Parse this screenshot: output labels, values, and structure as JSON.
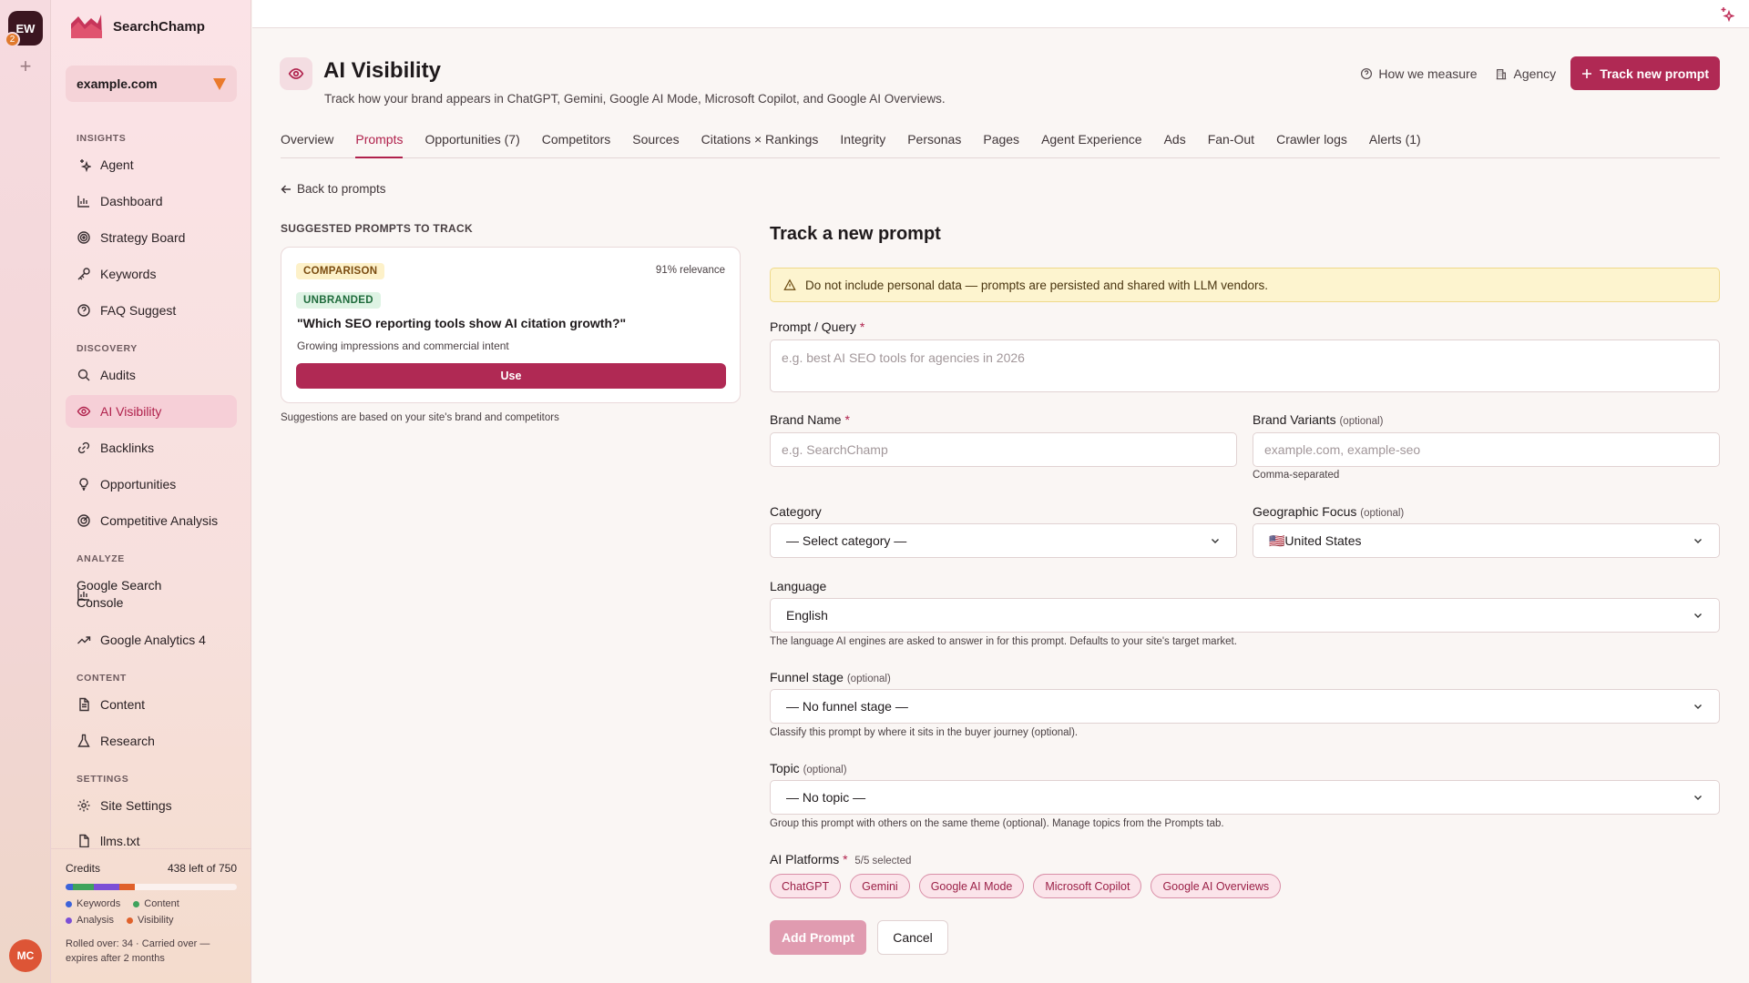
{
  "rail": {
    "workspace_initials": "EW",
    "workspace_count": "2",
    "add": "+",
    "avatar_initials": "MC"
  },
  "brand": {
    "name": "SearchChamp"
  },
  "site": {
    "selected": "example.com"
  },
  "sidebar": {
    "sections": {
      "insights": "INSIGHTS",
      "discovery": "DISCOVERY",
      "analyze": "ANALYZE",
      "content": "CONTENT",
      "settings": "SETTINGS"
    },
    "items": {
      "agent": "Agent",
      "dashboard": "Dashboard",
      "strategy": "Strategy Board",
      "keywords": "Keywords",
      "faq": "FAQ Suggest",
      "audits": "Audits",
      "ai_visibility": "AI Visibility",
      "backlinks": "Backlinks",
      "opportunities": "Opportunities",
      "competitive": "Competitive Analysis",
      "gsc_1": "Google Search",
      "gsc_2": "Console",
      "ga4": "Google Analytics 4",
      "content": "Content",
      "research": "Research",
      "site_settings": "Site Settings",
      "llms": "llms.txt"
    }
  },
  "credits": {
    "label": "Credits",
    "remaining": "438 left of 750",
    "segments": [
      {
        "name": "Keywords",
        "fraction": 0.045,
        "color": "#3d63d9"
      },
      {
        "name": "Content",
        "fraction": 0.12,
        "color": "#3fa35c"
      },
      {
        "name": "Analysis",
        "fraction": 0.15,
        "color": "#7c4fd6"
      },
      {
        "name": "Visibility",
        "fraction": 0.09,
        "color": "#e0612b"
      }
    ],
    "legend": {
      "keywords": "Keywords",
      "content": "Content",
      "analysis": "Analysis",
      "visibility": "Visibility"
    },
    "rollover_1": "Rolled over: 34 · Carried over —",
    "rollover_2": "expires after 2 months"
  },
  "header": {
    "title": "AI Visibility",
    "subtitle": "Track how your brand appears in ChatGPT, Gemini, Google AI Mode, Microsoft Copilot, and Google AI Overviews.",
    "how_we_measure": "How we measure",
    "agency": "Agency",
    "track_new": "Track new prompt"
  },
  "tabs": [
    {
      "label": "Overview"
    },
    {
      "label": "Prompts"
    },
    {
      "label": "Opportunities (7)"
    },
    {
      "label": "Competitors"
    },
    {
      "label": "Sources"
    },
    {
      "label": "Citations × Rankings"
    },
    {
      "label": "Integrity"
    },
    {
      "label": "Personas"
    },
    {
      "label": "Pages"
    },
    {
      "label": "Agent Experience"
    },
    {
      "label": "Ads"
    },
    {
      "label": "Fan-Out"
    },
    {
      "label": "Crawler logs"
    },
    {
      "label": "Alerts (1)"
    }
  ],
  "back": "Back to prompts",
  "suggestions": {
    "heading": "SUGGESTED PROMPTS TO TRACK",
    "card": {
      "type": "COMPARISON",
      "branding": "UNBRANDED",
      "relevance": "91% relevance",
      "query": "\"Which SEO reporting tools show AI citation growth?\"",
      "reason": "Growing impressions and commercial intent",
      "use": "Use"
    },
    "note": "Suggestions are based on your site's brand and competitors"
  },
  "form": {
    "title": "Track a new prompt",
    "warning": "Do not include personal data — prompts are persisted and shared with LLM vendors.",
    "prompt_label": "Prompt / Query",
    "req": "*",
    "prompt_placeholder": "e.g. best AI SEO tools for agencies in 2026",
    "brand_label": "Brand Name",
    "brand_placeholder": "e.g. SearchChamp",
    "variants_label": "Brand Variants",
    "optional": "(optional)",
    "variants_placeholder": "example.com, example-seo",
    "variants_help": "Comma-separated",
    "category_label": "Category",
    "category_value": "— Select category —",
    "geo_label": "Geographic Focus",
    "geo_value": "🇺🇸United States",
    "language_label": "Language",
    "language_value": "English",
    "language_help": "The language AI engines are asked to answer in for this prompt. Defaults to your site's target market.",
    "funnel_label": "Funnel stage",
    "funnel_value": "— No funnel stage —",
    "funnel_help": "Classify this prompt by where it sits in the buyer journey (optional).",
    "topic_label": "Topic",
    "topic_value": "— No topic —",
    "topic_help": "Group this prompt with others on the same theme (optional). Manage topics from the Prompts tab.",
    "platforms_label": "AI Platforms",
    "platforms_count": "5/5 selected",
    "platforms": [
      "ChatGPT",
      "Gemini",
      "Google AI Mode",
      "Microsoft Copilot",
      "Google AI Overviews"
    ],
    "add": "Add Prompt",
    "cancel": "Cancel"
  }
}
